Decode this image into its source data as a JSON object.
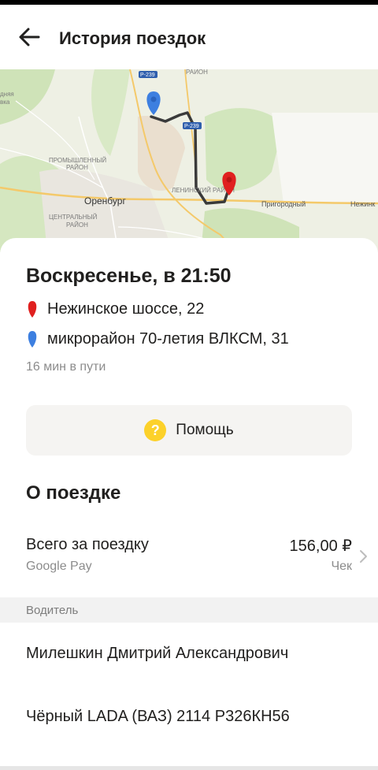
{
  "header": {
    "title": "История поездок"
  },
  "map": {
    "labels": {
      "road_p239_top": "Р-239",
      "district_top": "РАЙОН",
      "road_p239_mid": "Р-239",
      "village_left": "дняя",
      "village_left2": "вка",
      "promyshlenny_1": "ПРОМЫШЛЕННЫЙ",
      "promyshlenny_2": "РАЙОН",
      "city": "Оренбург",
      "leninsky": "ЛЕНИНСКИЙ РАЙОН",
      "prigorodny": "Пригородный",
      "nezhinka": "Нежинк",
      "centralny_1": "ЦЕНТРАЛЬНЫЙ",
      "centralny_2": "РАЙОН"
    },
    "colors": {
      "start_pin": "#3d7fe0",
      "end_pin": "#e0201f",
      "route": "#3a3a3a"
    }
  },
  "trip": {
    "date": "Воскресенье, в 21:50",
    "destination": "Нежинское шоссе, 22",
    "origin": "микрорайон 70-летия ВЛКСМ, 31",
    "duration": "16 мин в пути"
  },
  "help": {
    "icon": "question-icon",
    "label": "Помощь"
  },
  "about": {
    "title": "О поездке",
    "total_label": "Всего за поездку",
    "payment_method": "Google Pay",
    "price": "156,00 ₽",
    "receipt": "Чек"
  },
  "driver_section": {
    "title": "Водитель",
    "name": "Милешкин Дмитрий Александрович",
    "car": "Чёрный LADA (ВАЗ) 2114 Р326КН56"
  }
}
